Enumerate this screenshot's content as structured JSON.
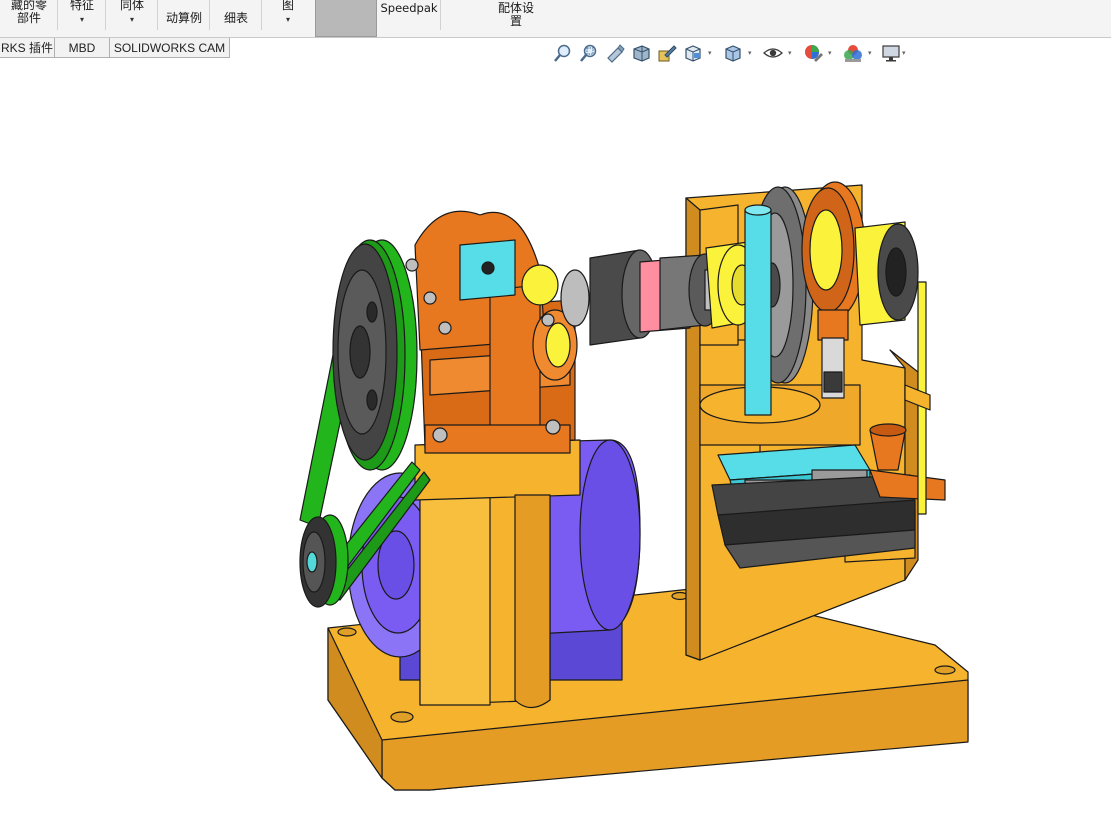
{
  "ribbon": {
    "items": [
      {
        "label1": "藏的零",
        "label2": "部件",
        "dropdown": false
      },
      {
        "label1": "特征",
        "label2": "",
        "dropdown": true
      },
      {
        "label1": "同体",
        "label2": "",
        "dropdown": true
      },
      {
        "label1": "",
        "label2": "动算例",
        "dropdown": false
      },
      {
        "label1": "",
        "label2": "细表",
        "dropdown": false
      },
      {
        "label1": "图",
        "label2": "",
        "dropdown": true
      },
      {
        "label1": "",
        "label2": "Speedpak",
        "dropdown": false
      },
      {
        "label1": "配体设",
        "label2": "置",
        "dropdown": false
      }
    ],
    "dropdown_glyph": "▾"
  },
  "tabs": [
    "RKS 插件",
    "MBD",
    "SOLIDWORKS CAM"
  ],
  "view_toolbar": {
    "icons": [
      "zoom-to-fit-icon",
      "zoom-to-area-icon",
      "previous-view-icon",
      "section-view-icon",
      "dynamic-annotation-icon",
      "view-orientation-icon",
      "display-style-icon",
      "hide-show-items-icon",
      "edit-appearance-icon",
      "apply-scene-icon",
      "view-settings-icon"
    ],
    "dropdown_glyph": "▾"
  },
  "colors": {
    "base_yellow": "#f6b32e",
    "base_shadow": "#d08c1e",
    "gear_orange": "#e8781f",
    "belt_green": "#23b51c",
    "motor_blue": "#7b5cf2",
    "coupling_grey": "#555555",
    "cyan_part": "#56dde8",
    "yellow_bearing": "#fbf23c",
    "flywheel_grey": "#8a8a8a",
    "outline": "#1a1a1a"
  }
}
